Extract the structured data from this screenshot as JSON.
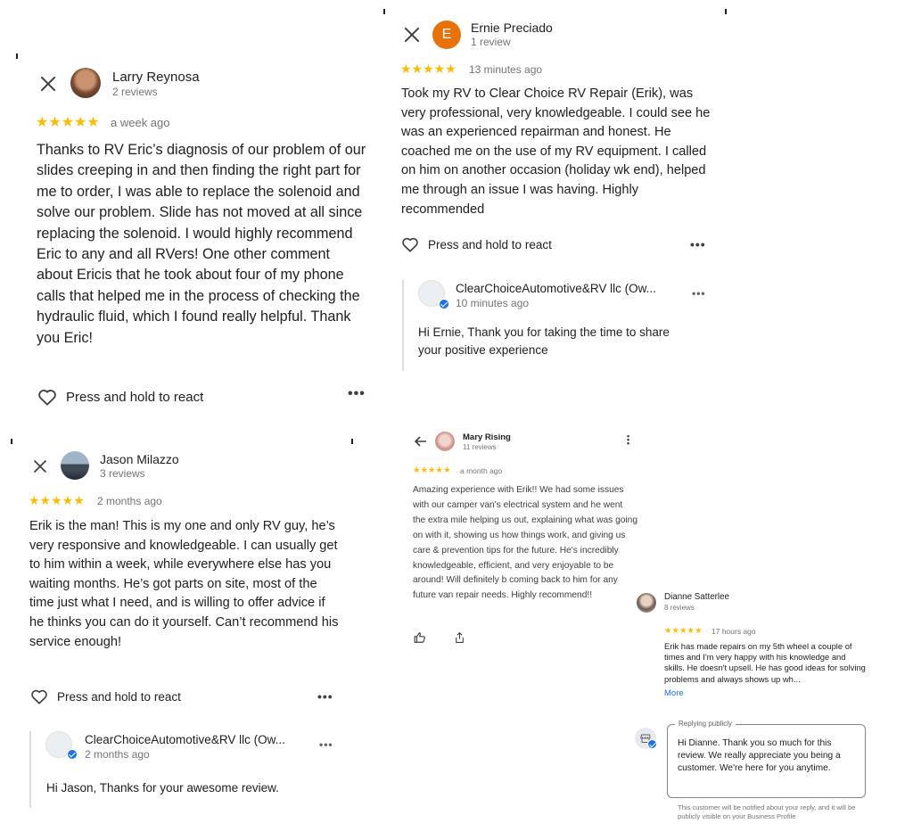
{
  "panel1": {
    "name": "Larry Reynosa",
    "reviews": "2 reviews",
    "stars": "★★★★★",
    "time": "a week ago",
    "text": "Thanks to RV Eric’s diagnosis of our problem of our slides creeping in and then finding the right part for me to order, I was able to replace the solenoid and solve our problem. Slide has not moved at all since replacing the solenoid. I would highly recommend Eric to any and all RVers! One other comment about Ericis that he took about four of my phone calls that helped me in the process of checking the hydraulic fluid, which I found really helpful. Thank you Eric!",
    "react": "Press and hold to react"
  },
  "panel2": {
    "initial": "E",
    "avatar_color": "#e8710a",
    "name": "Ernie Preciado",
    "reviews": "1 review",
    "stars": "★★★★★",
    "time": "13 minutes ago",
    "text": "Took my RV to Clear Choice RV Repair (Erik), was very professional, very knowledgeable. I could see he was an experienced repairman and honest. He coached me on the use of my RV equipment. I called on him on another occasion (holiday wk end), helped me through an issue I was having. Highly recommended",
    "react": "Press and hold to react",
    "reply_name": "ClearChoiceAutomotive&RV llc (Ow...",
    "reply_time": "10 minutes ago",
    "reply_text": "Hi Ernie, Thank you for taking the time to share your positive experience"
  },
  "panel3": {
    "name": "Jason Milazzo",
    "reviews": "3 reviews",
    "stars": "★★★★★",
    "time": "2 months ago",
    "text": "Erik is the man! This is my one and only RV guy, he’s very responsive and knowledgeable. I can usually get to him within a week, while everywhere else has you waiting months. He’s got parts on site, most of the time just what I need, and is willing to offer advice if he thinks you can do it yourself. Can’t recommend his service enough!",
    "react": "Press and hold to react",
    "reply_name": "ClearChoiceAutomotive&RV llc (Ow...",
    "reply_time": "2 months ago",
    "reply_text": "Hi Jason, Thanks for your awesome review."
  },
  "panel4": {
    "name": "Mary Rising",
    "reviews": "11 reviews",
    "stars": "★★★★★",
    "time": "a month ago",
    "text": "Amazing experience with Erik!! We had some issues with our camper van's electrical system and he went the extra mile helping us out, explaining what was going on with it, showing us how things work, and giving us care & prevention tips for the future. He's incredibly knowledgeable, efficient, and very enjoyable to be around! Will definitely b coming back to him for any future van repair needs. Highly recommend!!"
  },
  "panel5": {
    "name": "Dianne Satterlee",
    "reviews": "8 reviews",
    "stars": "★★★★★",
    "time": "17 hours ago",
    "text": "Erik has made repairs on my 5th wheel a couple of times and I'm very happy with his knowledge and skills. He doesn't upsell. He has good ideas for solving problems and always shows up wh...",
    "more": "More",
    "reply_label": "Replying publicly",
    "reply_text": "Hi Dianne. Thank you so much for this review. We really appreciate you being a customer. We're here for you anytime.",
    "notice": "This customer will be notified about your reply, and it will be publicly visible on your Business Profile"
  },
  "colors": {
    "star": "#fbbc04",
    "verified": "#1a73e8",
    "link": "#1a73e8"
  }
}
